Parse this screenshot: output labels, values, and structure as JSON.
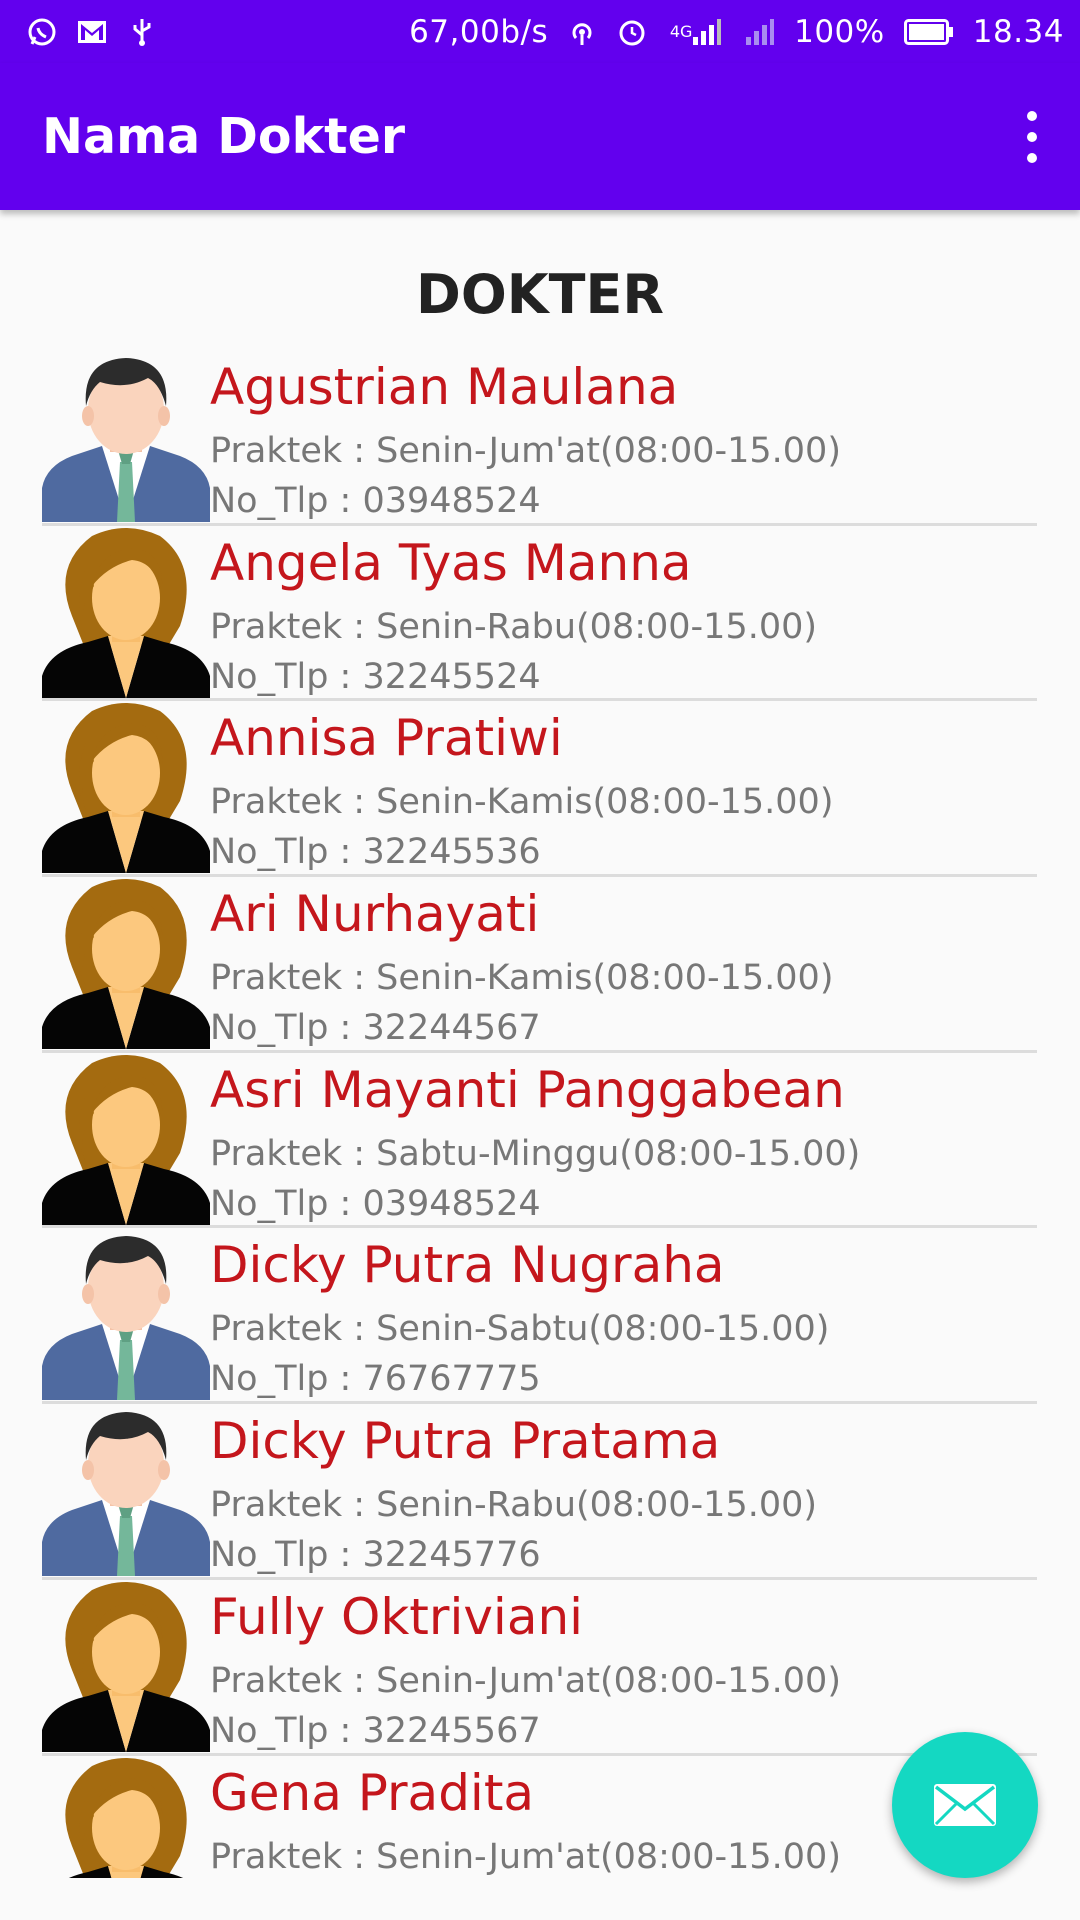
{
  "status_bar": {
    "speed": "67,00b/s",
    "network": "4G",
    "battery": "100%",
    "time": "18.34",
    "icons": [
      "whatsapp-icon",
      "gmail-icon",
      "usb-icon",
      "hotspot-icon",
      "alarm-icon",
      "signal-icon",
      "signal-empty-icon",
      "battery-icon"
    ]
  },
  "app_bar": {
    "title": "Nama Dokter",
    "menu_icon": "more-vert-icon"
  },
  "heading": "DOKTER",
  "doctors": [
    {
      "name": "Agustrian Maulana",
      "schedule": "Praktek : Senin-Jum'at(08:00-15.00)",
      "phone": "No_Tlp : 03948524",
      "avatar": "male"
    },
    {
      "name": "Angela Tyas Manna",
      "schedule": "Praktek : Senin-Rabu(08:00-15.00)",
      "phone": "No_Tlp : 32245524",
      "avatar": "female"
    },
    {
      "name": "Annisa Pratiwi",
      "schedule": "Praktek : Senin-Kamis(08:00-15.00)",
      "phone": "No_Tlp : 32245536",
      "avatar": "female"
    },
    {
      "name": "Ari Nurhayati",
      "schedule": "Praktek : Senin-Kamis(08:00-15.00)",
      "phone": "No_Tlp : 32244567",
      "avatar": "female"
    },
    {
      "name": "Asri Mayanti Panggabean",
      "schedule": "Praktek : Sabtu-Minggu(08:00-15.00)",
      "phone": "No_Tlp : 03948524",
      "avatar": "female"
    },
    {
      "name": "Dicky Putra Nugraha",
      "schedule": "Praktek : Senin-Sabtu(08:00-15.00)",
      "phone": "No_Tlp : 76767775",
      "avatar": "male"
    },
    {
      "name": "Dicky Putra Pratama",
      "schedule": "Praktek : Senin-Rabu(08:00-15.00)",
      "phone": "No_Tlp : 32245776",
      "avatar": "male"
    },
    {
      "name": "Fully Oktriviani",
      "schedule": "Praktek : Senin-Jum'at(08:00-15.00)",
      "phone": "No_Tlp : 32245567",
      "avatar": "female"
    },
    {
      "name": "Gena Pradita",
      "schedule": "Praktek : Senin-Jum'at(08:00-15.00)",
      "phone": "",
      "avatar": "female"
    }
  ],
  "fab": {
    "icon": "mail-icon"
  },
  "colors": {
    "primary": "#6200ee",
    "name_text": "#c4161c",
    "fab": "#14d8c2"
  }
}
